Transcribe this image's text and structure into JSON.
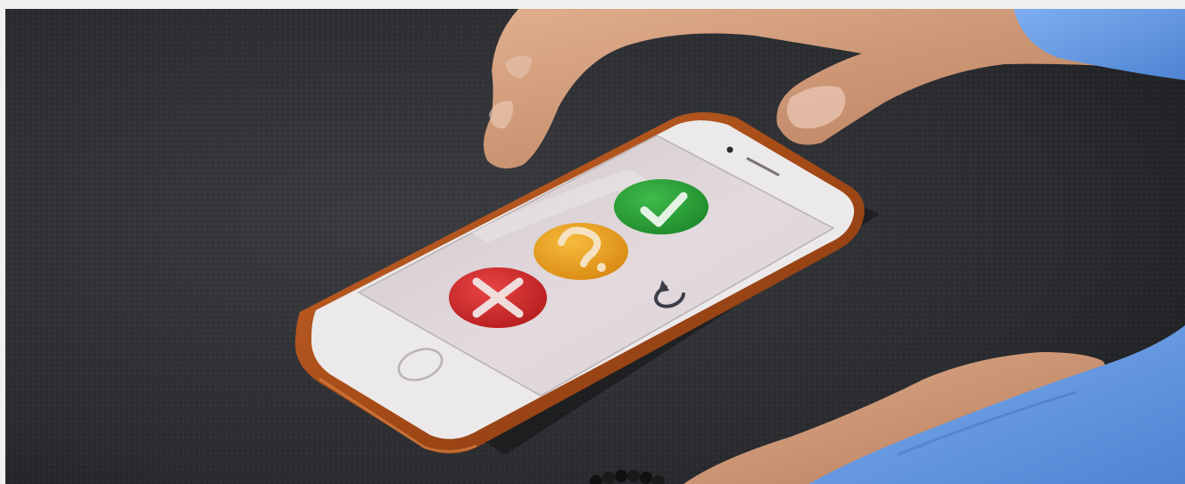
{
  "scene": {
    "subject": "smartphone-on-table",
    "colors": {
      "table": "#2a2b2e",
      "phone_case": "#b8581f",
      "phone_body": "#ece9ea",
      "screen": "#ded6d9",
      "skin": "#d6a07f",
      "sleeve": "#6a9be0"
    }
  },
  "app": {
    "buttons": [
      {
        "id": "no",
        "glyph": "x-mark",
        "color": "#d42c2c"
      },
      {
        "id": "maybe",
        "glyph": "question-mark",
        "color": "#f0a51f"
      },
      {
        "id": "yes",
        "glyph": "check-mark",
        "color": "#2ea33a"
      }
    ],
    "reset_icon": "refresh-icon",
    "reset_color": "#3e3e48"
  }
}
